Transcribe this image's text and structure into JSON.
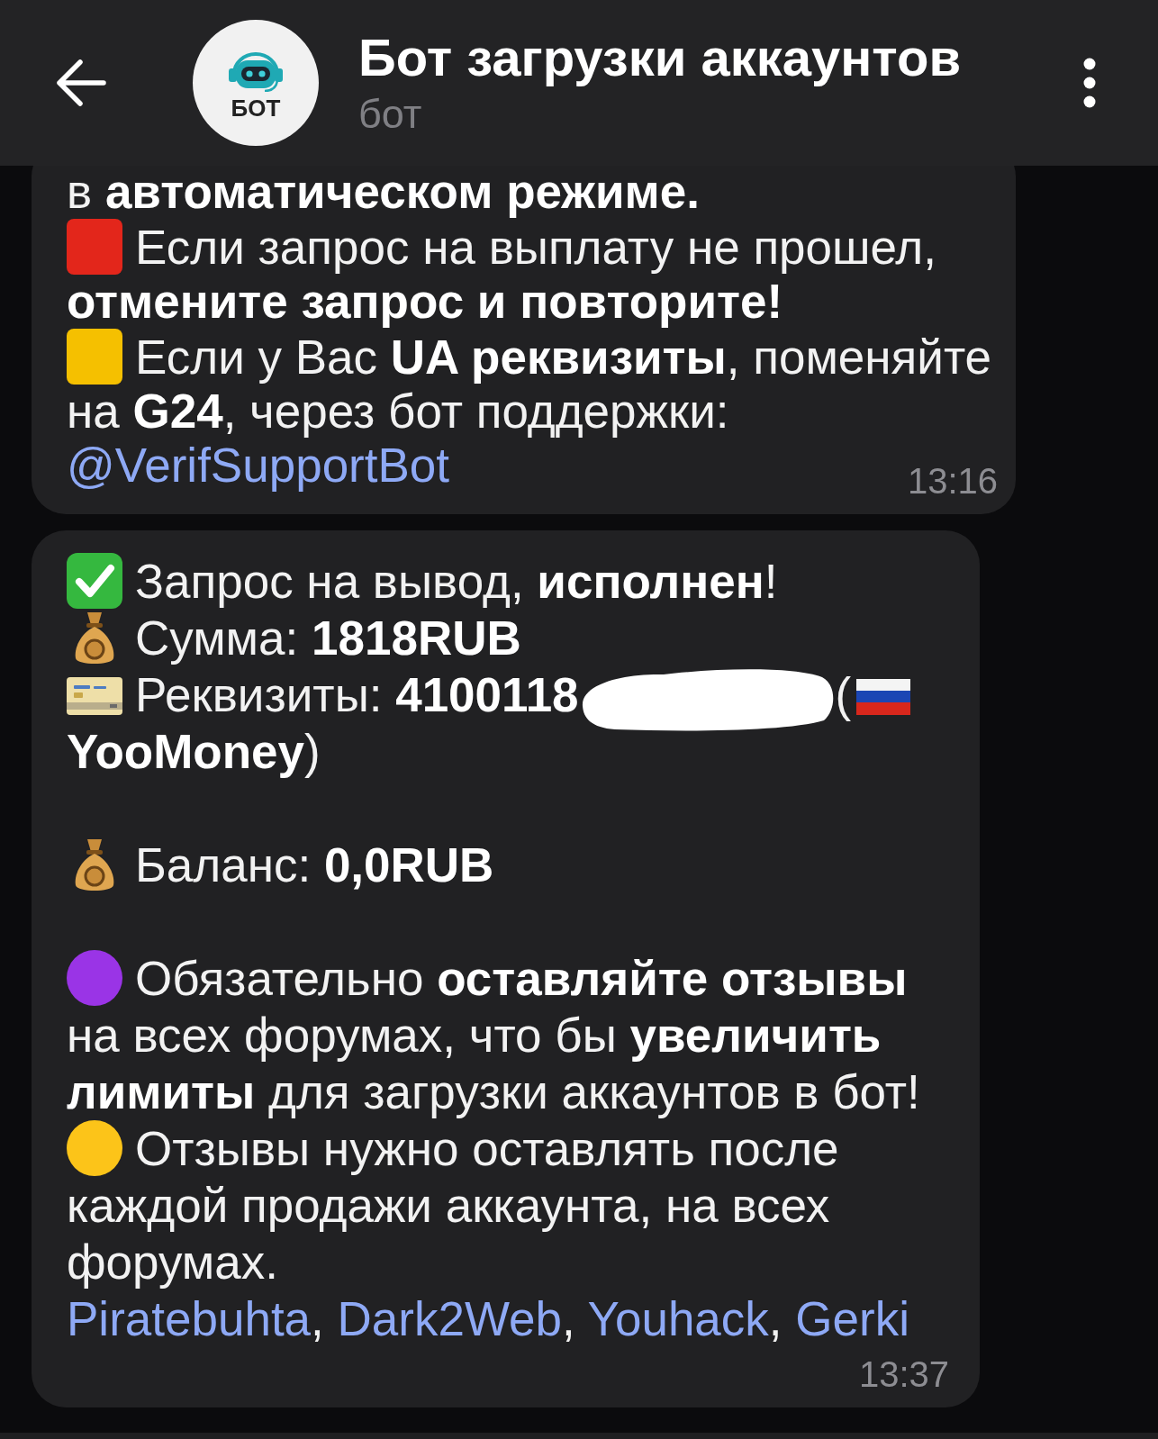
{
  "header": {
    "title": "Бот загрузки аккаунтов",
    "subtitle": "бот",
    "avatar_label": "БОТ"
  },
  "messages": [
    {
      "time": "13:16",
      "sections": [
        [
          {
            "parts": [
              {
                "kind": "text",
                "text": "в **автоматическом режиме.**"
              }
            ]
          },
          {
            "parts": [
              {
                "kind": "square",
                "color": "#e3261b"
              },
              {
                "kind": "text",
                "text": "Если запрос на выплату не прошел, **отмените запрос и повторите!**"
              }
            ]
          },
          {
            "parts": [
              {
                "kind": "square",
                "color": "#f5c000"
              },
              {
                "kind": "text",
                "text": "Если у Вас **UA реквизиты**, поменяйте на **G24**, через бот поддержки:"
              }
            ]
          },
          {
            "parts": [
              {
                "kind": "mention",
                "text": "@VerifSupportBot"
              }
            ]
          }
        ]
      ]
    },
    {
      "time": "13:37",
      "sections": [
        [
          {
            "parts": [
              {
                "kind": "check"
              },
              {
                "kind": "text",
                "text": "Запрос на вывод, **исполнен**!"
              }
            ]
          },
          {
            "parts": [
              {
                "kind": "moneybag"
              },
              {
                "kind": "text",
                "text": "Сумма: **1818RUB**"
              }
            ]
          },
          {
            "parts": [
              {
                "kind": "card"
              },
              {
                "kind": "text",
                "text": "Реквизиты: **4100118**"
              },
              {
                "kind": "redaction"
              },
              {
                "kind": "text",
                "text": "("
              },
              {
                "kind": "flag"
              },
              {
                "kind": "text",
                "text": "**YooMoney**)"
              }
            ]
          }
        ],
        [
          {
            "parts": [
              {
                "kind": "moneybag"
              },
              {
                "kind": "text",
                "text": "Баланс: **0,0RUB**"
              }
            ]
          }
        ],
        [
          {
            "parts": [
              {
                "kind": "circle",
                "color": "#9a34e6"
              },
              {
                "kind": "text",
                "text": "Обязательно **оставляйте отзывы** на всех форумах, что бы **увеличить лимиты** для загрузки аккаунтов в бот!"
              }
            ]
          },
          {
            "parts": [
              {
                "kind": "circle",
                "color": "#fcc419"
              },
              {
                "kind": "text",
                "text": "Отзывы нужно оставлять после каждой продажи аккаунта, на всех форумах."
              }
            ]
          },
          {
            "parts": [
              {
                "kind": "links",
                "items": [
                  {
                    "label": "Piratebuhta",
                    "after": ", "
                  },
                  {
                    "label": "Dark2Web",
                    "after": ", "
                  },
                  {
                    "label": "Youhack",
                    "after": ", "
                  },
                  {
                    "label": "Gerki"
                  }
                ]
              }
            ]
          }
        ]
      ]
    }
  ]
}
